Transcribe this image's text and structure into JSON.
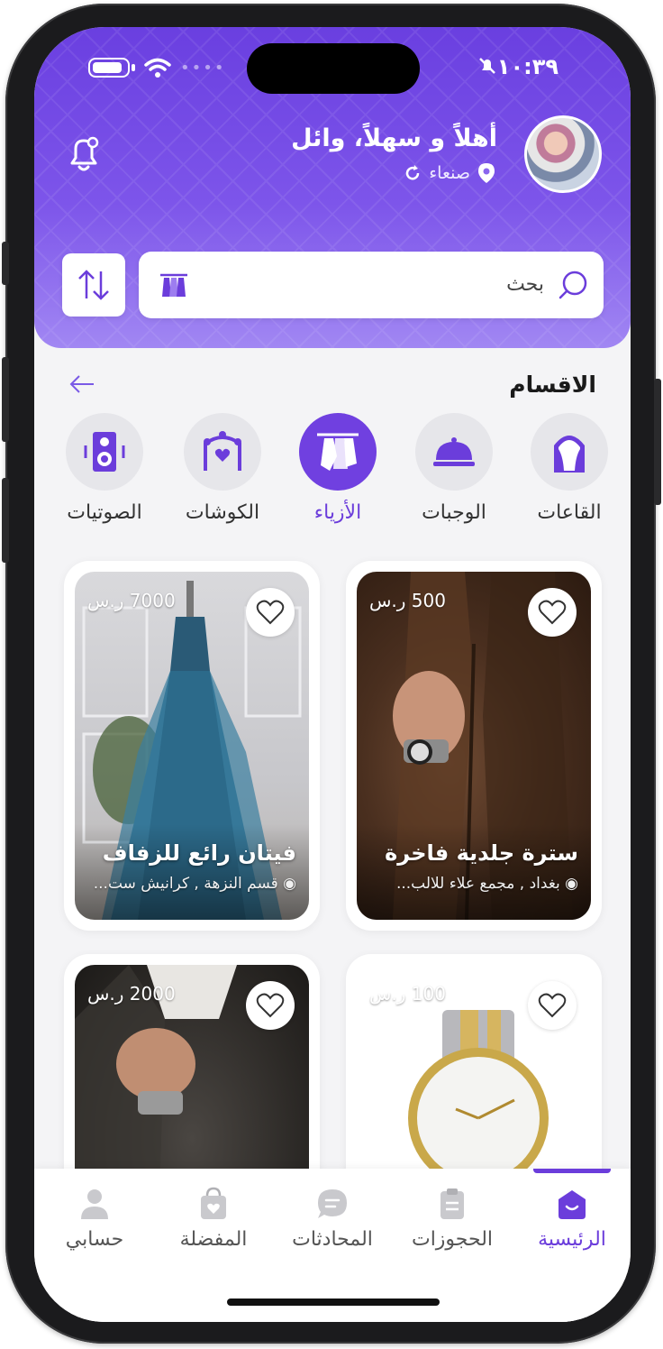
{
  "status": {
    "time": "١٠:٣٩"
  },
  "header": {
    "greeting": "أهلاً و سهلاً، وائل",
    "location": "صنعاء"
  },
  "search": {
    "placeholder": "بحث"
  },
  "categories": {
    "title": "الاقسام",
    "items": [
      {
        "label": "القاعات",
        "icon": "hall-arch-icon"
      },
      {
        "label": "الوجبات",
        "icon": "meal-cloche-icon"
      },
      {
        "label": "الأزياء",
        "icon": "fashion-hanger-icon",
        "active": true
      },
      {
        "label": "الكوشات",
        "icon": "wedding-stage-icon"
      },
      {
        "label": "الصوتيات",
        "icon": "speaker-icon"
      }
    ]
  },
  "products": [
    {
      "price": "500 ر.س",
      "title": "سترة جلدية فاخرة",
      "location": "بغداد , مجمع علاء للالب..."
    },
    {
      "price": "7000 ر.س",
      "title": "فيتان رائع للزفاف",
      "location": "قسم النزهة , كرانيش ست..."
    },
    {
      "price": "100 ر.س"
    },
    {
      "price": "2000 ر.س"
    }
  ],
  "bottom_nav": [
    {
      "label": "الرئيسية",
      "icon": "home-icon",
      "active": true
    },
    {
      "label": "الحجوزات",
      "icon": "clipboard-icon"
    },
    {
      "label": "المحادثات",
      "icon": "chat-icon"
    },
    {
      "label": "المفضلة",
      "icon": "shopping-bag-heart-icon"
    },
    {
      "label": "حسابي",
      "icon": "user-icon"
    }
  ],
  "colors": {
    "brand": "#6b3ddb",
    "header_top": "#6a3fe0",
    "header_bottom": "#a187f3"
  }
}
